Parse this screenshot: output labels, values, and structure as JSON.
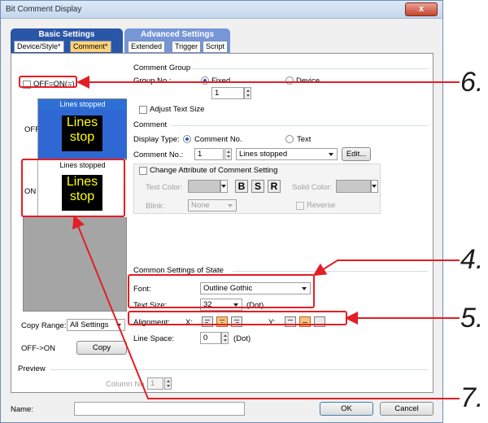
{
  "window": {
    "title": "Bit Comment Display",
    "close_label": "x"
  },
  "tabs": {
    "basic": {
      "label": "Basic Settings",
      "sub": [
        "Device/Style*",
        "Comment*"
      ]
    },
    "advanced": {
      "label": "Advanced Settings",
      "sub": [
        "Extended",
        "Trigger",
        "Script"
      ]
    }
  },
  "preview_panel": {
    "off_on_checkbox_label": "OFF=ON(=)",
    "off": {
      "state_label": "OFF",
      "caption": "Lines stopped",
      "lamp_line1": "Lines",
      "lamp_line2": "stop"
    },
    "on": {
      "state_label": "ON",
      "caption": "Lines stopped",
      "lamp_line1": "Lines",
      "lamp_line2": "stop"
    },
    "copy_range_label": "Copy Range:",
    "copy_range_value": "All Settings",
    "off_to_on_label": "OFF->ON",
    "copy_button": "Copy"
  },
  "comment_group": {
    "section": "Comment Group",
    "group_no_label": "Group No.:",
    "fixed_label": "Fixed",
    "device_label": "Device",
    "group_no_value": "1"
  },
  "adjust_text_size": "Adjust Text Size",
  "comment": {
    "section": "Comment",
    "display_type_label": "Display Type:",
    "comment_no_radio": "Comment No.",
    "text_radio": "Text",
    "comment_no_label": "Comment No.:",
    "comment_no_value": "1",
    "comment_select": "Lines stopped",
    "edit_button": "Edit...",
    "change_attr_label": "Change Attribute of Comment Setting",
    "text_color_label": "Text Color:",
    "solid_color_label": "Solid Color:",
    "blink_label": "Blink:",
    "blink_value": "None",
    "reverse_label": "Reverse",
    "style_b": "B",
    "style_s": "S",
    "style_r": "R"
  },
  "common_state": {
    "section": "Common Settings of State",
    "font_label": "Font:",
    "font_value": "Outline Gothic",
    "text_size_label": "Text Size:",
    "text_size_value": "32",
    "text_size_unit": "(Dot)",
    "alignment_label": "Alignment:",
    "x_label": "X:",
    "y_label": "Y:",
    "line_space_label": "Line Space:",
    "line_space_value": "0",
    "line_space_unit": "(Dot)"
  },
  "preview": {
    "section": "Preview",
    "column_no_label": "Column No.",
    "column_no_value": "1"
  },
  "footer": {
    "name_label": "Name:",
    "name_value": "",
    "ok_button": "OK",
    "cancel_button": "Cancel"
  },
  "callouts": [
    "6.",
    "4.",
    "5.",
    "7."
  ],
  "colors": {
    "annotation_red": "#e31e24",
    "lamp_text": "#ffff00",
    "basic_tab": "#2a56a8",
    "advanced_tab": "#7696d8"
  }
}
